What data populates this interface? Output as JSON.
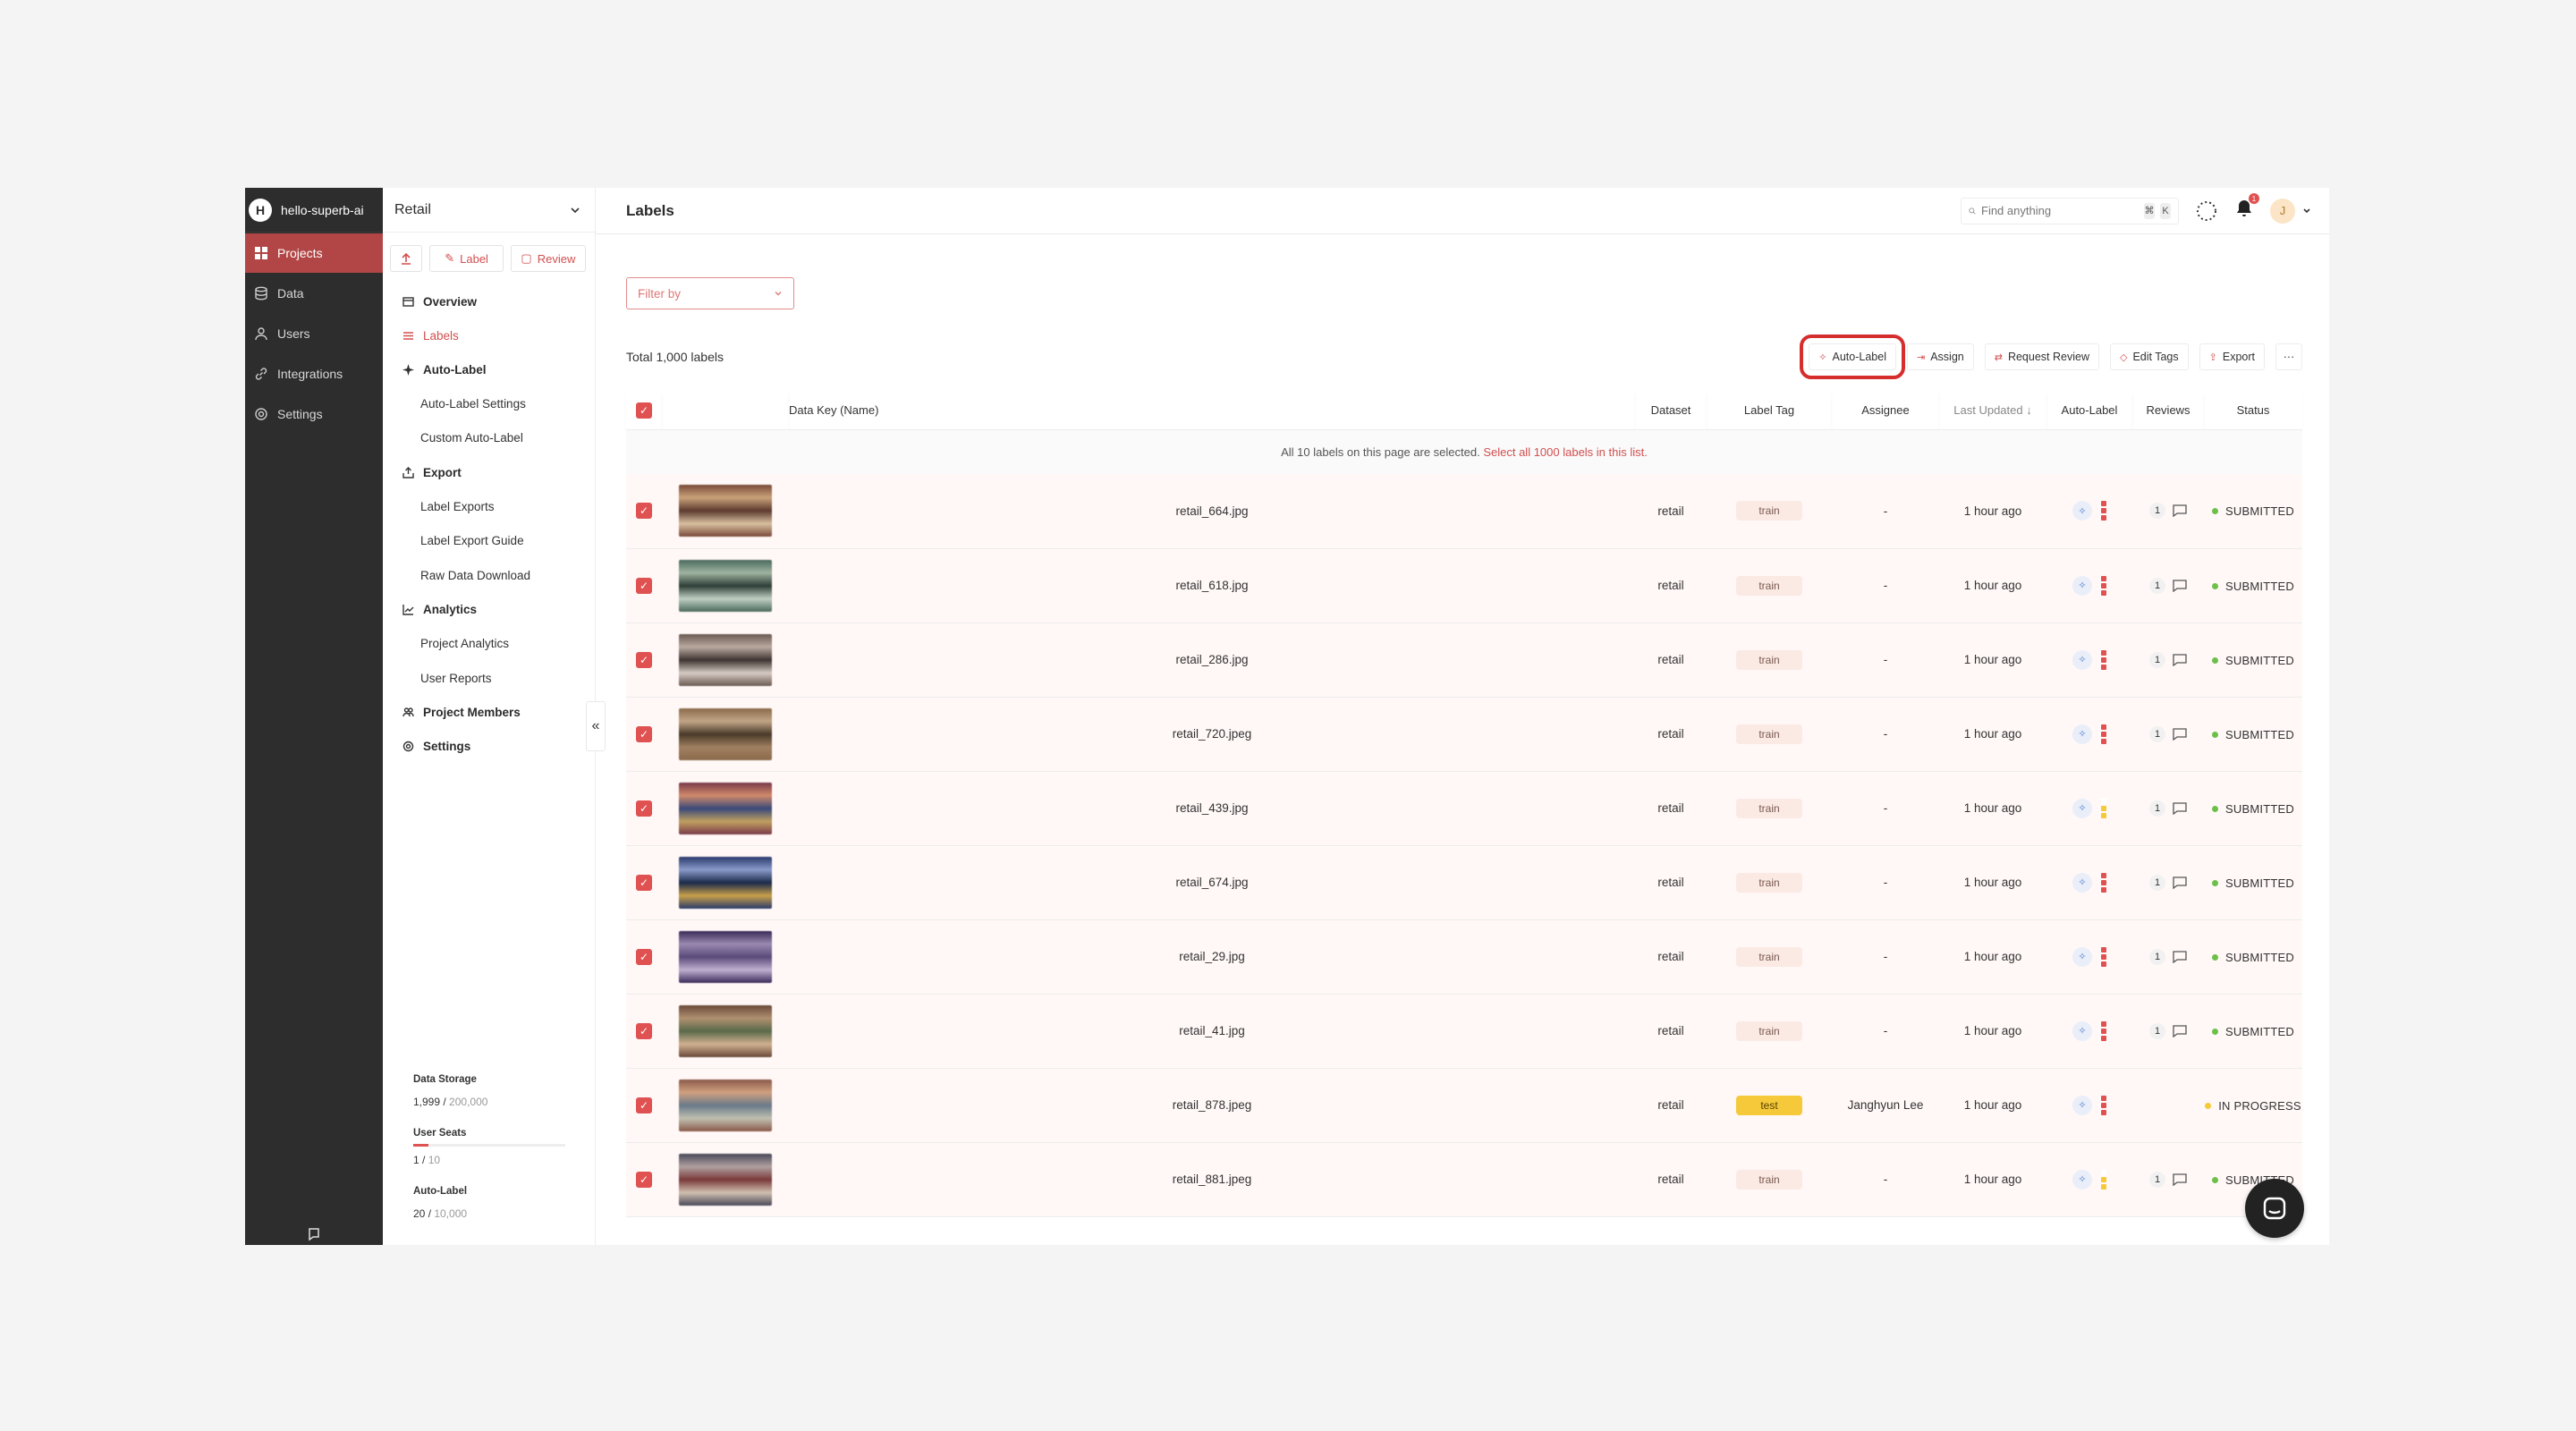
{
  "org": {
    "initial": "H",
    "name": "hello-superb-ai"
  },
  "nav": [
    {
      "label": "Projects",
      "icon": "grid-icon",
      "active": true
    },
    {
      "label": "Data",
      "icon": "database-icon"
    },
    {
      "label": "Users",
      "icon": "user-icon"
    },
    {
      "label": "Integrations",
      "icon": "link-icon"
    },
    {
      "label": "Settings",
      "icon": "gear-icon"
    }
  ],
  "project": {
    "name": "Retail",
    "actions": {
      "label": "Label",
      "review": "Review"
    },
    "menu": {
      "overview": "Overview",
      "labels": "Labels",
      "auto_label": "Auto-Label",
      "auto_label_settings": "Auto-Label Settings",
      "custom_auto_label": "Custom Auto-Label",
      "export": "Export",
      "label_exports": "Label Exports",
      "label_export_guide": "Label Export Guide",
      "raw_data_download": "Raw Data Download",
      "analytics": "Analytics",
      "project_analytics": "Project Analytics",
      "user_reports": "User Reports",
      "project_members": "Project Members",
      "settings": "Settings"
    },
    "usage": {
      "storage_title": "Data Storage",
      "storage_used": "1,999",
      "storage_total": "200,000",
      "seats_title": "User Seats",
      "seats_used": "1",
      "seats_total": "10",
      "auto_title": "Auto-Label",
      "auto_used": "20",
      "auto_total": "10,000"
    }
  },
  "topbar": {
    "title": "Labels",
    "search_placeholder": "Find anything",
    "kbd1": "⌘",
    "kbd2": "K",
    "notif_count": "1",
    "user_initial": "J"
  },
  "filter_placeholder": "Filter by",
  "total_text": "Total 1,000 labels",
  "actions": {
    "auto_label": "Auto-Label",
    "assign": "Assign",
    "request_review": "Request Review",
    "edit_tags": "Edit Tags",
    "export": "Export",
    "more": "···"
  },
  "columns": {
    "data_key": "Data Key (Name)",
    "dataset": "Dataset",
    "label_tag": "Label Tag",
    "assignee": "Assignee",
    "last_updated": "Last Updated ↓",
    "auto_label": "Auto-Label",
    "reviews": "Reviews",
    "status": "Status"
  },
  "banner": {
    "text": "All 10 labels on this page are selected. ",
    "link": "Select all 1000 labels in this list."
  },
  "rows": [
    {
      "name": "retail_664.jpg",
      "dataset": "retail",
      "tag": "train",
      "assignee": "-",
      "updated": "1 hour ago",
      "reviews": "1",
      "status": "SUBMITTED",
      "colors": [
        "#7a4a3a",
        "#c9a27a",
        "#5c3a2e",
        "#d8c0a0"
      ]
    },
    {
      "name": "retail_618.jpg",
      "dataset": "retail",
      "tag": "train",
      "assignee": "-",
      "updated": "1 hour ago",
      "reviews": "1",
      "status": "SUBMITTED",
      "colors": [
        "#4b6a5e",
        "#9fb3a0",
        "#2e3f38",
        "#c0cfc2"
      ]
    },
    {
      "name": "retail_286.jpg",
      "dataset": "retail",
      "tag": "train",
      "assignee": "-",
      "updated": "1 hour ago",
      "reviews": "1",
      "status": "SUBMITTED",
      "colors": [
        "#6a5a52",
        "#b9a9a0",
        "#3e3431",
        "#d6cbc4"
      ]
    },
    {
      "name": "retail_720.jpeg",
      "dataset": "retail",
      "tag": "train",
      "assignee": "-",
      "updated": "1 hour ago",
      "reviews": "1",
      "status": "SUBMITTED",
      "colors": [
        "#8a6a4a",
        "#c2a587",
        "#4a3a2a",
        "#a08060"
      ]
    },
    {
      "name": "retail_439.jpg",
      "dataset": "retail",
      "tag": "train",
      "assignee": "-",
      "updated": "1 hour ago",
      "reviews": "1",
      "status": "SUBMITTED",
      "colors": [
        "#7a3a4a",
        "#d08a6a",
        "#3a4a7a",
        "#c0a060"
      ]
    },
    {
      "name": "retail_674.jpg",
      "dataset": "retail",
      "tag": "train",
      "assignee": "-",
      "updated": "1 hour ago",
      "reviews": "1",
      "status": "SUBMITTED",
      "colors": [
        "#2a3a6a",
        "#8a9aca",
        "#1a2a4a",
        "#c8a04a"
      ]
    },
    {
      "name": "retail_29.jpg",
      "dataset": "retail",
      "tag": "train",
      "assignee": "-",
      "updated": "1 hour ago",
      "reviews": "1",
      "status": "SUBMITTED",
      "colors": [
        "#3a2a5a",
        "#9a8ab0",
        "#5a4a7a",
        "#c0b0d0"
      ]
    },
    {
      "name": "retail_41.jpg",
      "dataset": "retail",
      "tag": "train",
      "assignee": "-",
      "updated": "1 hour ago",
      "reviews": "1",
      "status": "SUBMITTED",
      "colors": [
        "#6a4a3a",
        "#b09070",
        "#5a6a4a",
        "#d0b090"
      ]
    },
    {
      "name": "retail_878.jpeg",
      "dataset": "retail",
      "tag": "test",
      "assignee": "Janghyun Lee",
      "updated": "1 hour ago",
      "reviews": "",
      "status": "IN PROGRESS",
      "colors": [
        "#8a5a4a",
        "#d0a080",
        "#6a7a8a",
        "#c0c0b0"
      ]
    },
    {
      "name": "retail_881.jpeg",
      "dataset": "retail",
      "tag": "train",
      "assignee": "-",
      "updated": "1 hour ago",
      "reviews": "1",
      "status": "SUBMITTED",
      "colors": [
        "#4a4a5a",
        "#b0a0a0",
        "#7a3a3a",
        "#d0c0b0"
      ]
    }
  ],
  "accent": "#d24f4f"
}
